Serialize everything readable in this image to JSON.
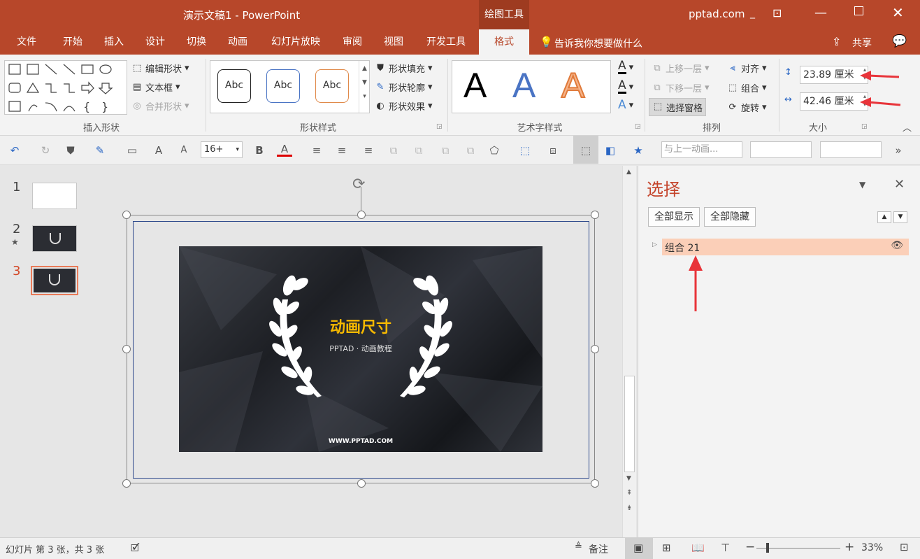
{
  "titlebar": {
    "doc_title": "演示文稿1 - PowerPoint",
    "context_tab": "绘图工具",
    "account": "pptad.com"
  },
  "tabs": [
    "文件",
    "开始",
    "插入",
    "设计",
    "切换",
    "动画",
    "幻灯片放映",
    "审阅",
    "视图",
    "开发工具",
    "格式"
  ],
  "tell_me": "告诉我你想要做什么",
  "share": "共享",
  "ribbon": {
    "insert_shapes": {
      "label": "插入形状",
      "edit_shape": "编辑形状",
      "text_box": "文本框",
      "merge_shapes": "合并形状"
    },
    "shape_styles": {
      "label": "形状样式",
      "sample": "Abc",
      "fill": "形状填充",
      "outline": "形状轮廓",
      "effects": "形状效果"
    },
    "wordart": {
      "label": "艺术字样式",
      "sample": "A"
    },
    "arrange": {
      "label": "排列",
      "bring_forward": "上移一层",
      "send_backward": "下移一层",
      "selection_pane": "选择窗格",
      "align": "对齐",
      "group": "组合",
      "rotate": "旋转"
    },
    "size": {
      "label": "大小",
      "height": "23.89 厘米",
      "width": "42.46 厘米"
    }
  },
  "qat": {
    "font_size": "16+",
    "animation_placeholder": "与上一动画..."
  },
  "slides": [
    {
      "num": "1",
      "star": ""
    },
    {
      "num": "2",
      "star": "★"
    },
    {
      "num": "3",
      "star": ""
    }
  ],
  "slide": {
    "title": "动画尺寸",
    "subtitle": "PPTAD · 动画教程",
    "url": "WWW.PPTAD.COM"
  },
  "selection_pane": {
    "title": "选择",
    "show_all": "全部显示",
    "hide_all": "全部隐藏",
    "items": [
      {
        "label": "组合 21"
      }
    ]
  },
  "status": {
    "slide_info": "幻灯片 第 3 张，共 3 张",
    "notes": "备注",
    "zoom": "33%"
  },
  "colors": {
    "accent": "#b7472a",
    "slide_title": "#f5b800",
    "selected_item": "#fbcfb8",
    "arrow": "#e8343a"
  }
}
